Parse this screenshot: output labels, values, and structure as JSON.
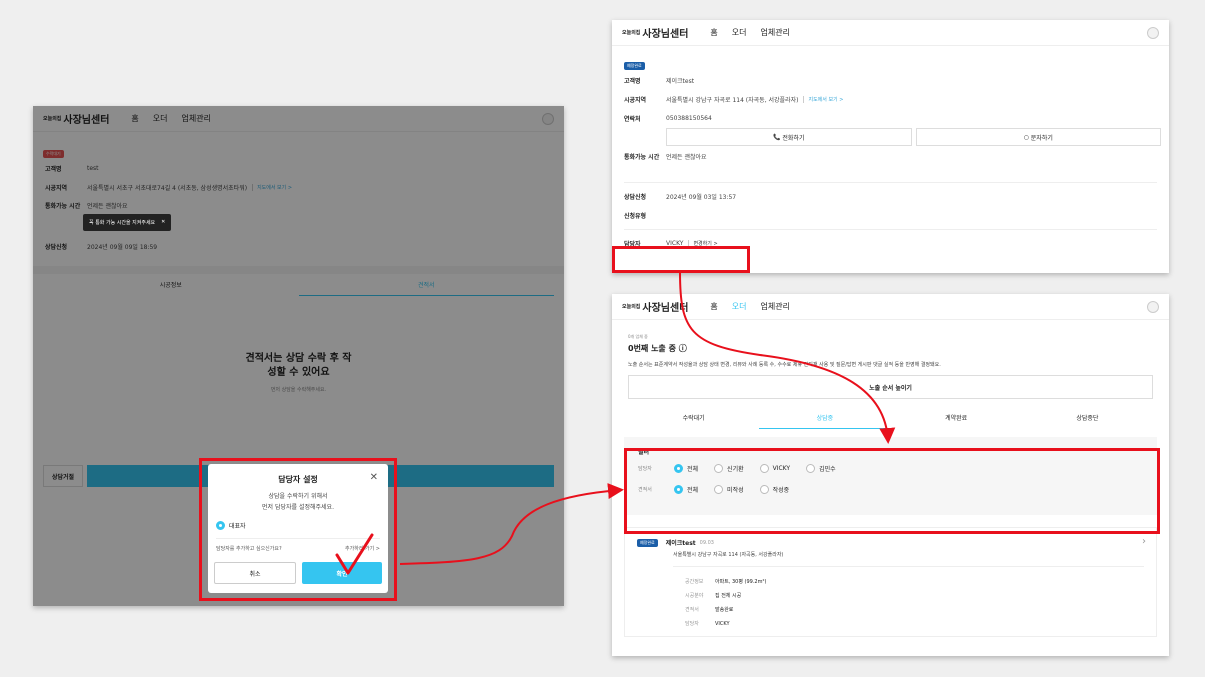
{
  "header": {
    "brand_small": "오늘의집",
    "brand": "사장님센터",
    "nav_home": "홈",
    "nav_order": "오더",
    "nav_company": "업체관리"
  },
  "left": {
    "status_badge": "수락대기",
    "name_label": "고객명",
    "name_value": "test",
    "area_label": "시공지역",
    "area_value": "서울특별시 서초구 서초대로74길 4 (서초동, 삼성생명서초타워)",
    "map_link": "지도에서 보기 >",
    "call_label": "통화가능 시간",
    "call_value": "언제든 괜찮아요",
    "tooltip": "꼭 통화 가능 시간을 지켜주세요",
    "request_label": "상담신청",
    "request_value": "2024년 09월 09일 18:59",
    "tab1": "시공정보",
    "tab2": "견적서",
    "estimate_title": "견적서는 상담 수락 후 작성할 수 있어요",
    "estimate_sub": "먼저 상담을 수락해주세요.",
    "reject_button": "상담거절",
    "modal": {
      "title": "담당자 설정",
      "body_line1": "상담을 수락하기 위해서",
      "body_line2": "먼저 담당자를 설정해주세요.",
      "option": "대표자",
      "add_question": "담당자를 추가하고 싶으신가요?",
      "add_link": "추가하러 가기 >",
      "cancel": "취소",
      "confirm": "확인"
    }
  },
  "topright": {
    "status_badge": "예정완료",
    "name_label": "고객명",
    "name_value": "제이크test",
    "area_label": "시공지역",
    "area_value": "서울특별시 강남구 자곡로 114 (자곡동, 서강플라자)",
    "map_link": "지도에서 보기 >",
    "phone_label": "연락처",
    "phone_value": "050388150564",
    "call_button": "전화하기",
    "msg_button": "문자하기",
    "call_label": "통화가능 시간",
    "call_value": "언제든 괜찮아요",
    "request_label": "상담신청",
    "request_value": "2024년 09월 03일 13:57",
    "type_label": "신청유형",
    "manager_label": "담당자",
    "manager_value": "VICKY",
    "change_link": "변경하기 >"
  },
  "bottomright": {
    "exposure_small": "0개 업체 중",
    "exposure_title": "0번째 노출 중 ⓘ",
    "exposure_desc": "노출 순서는 표준계약서 작성율과 상담 상태 변경, 리뷰와 사례 등록 수, 수수료 제휴 견지재 사용 및 질문/답변 게시판 댓글 실적 등을 반영해 결정돼요.",
    "raise_button": "노출 순서 높이기",
    "tabs": [
      "수락대기",
      "상담중",
      "계약완료",
      "상담중단"
    ],
    "filter_title": "필터",
    "filter_manager_label": "담당자",
    "filter_manager_options": [
      "전체",
      "신기환",
      "VICKY",
      "김민수"
    ],
    "filter_estimate_label": "견적서",
    "filter_estimate_options": [
      "전체",
      "미작성",
      "작성중"
    ],
    "card": {
      "badge": "예정완료",
      "name": "제이크test",
      "date": "09.03",
      "address": "서울특별시 강남구 자곡로 114 (자곡동, 서강플라자)",
      "k1": "공간정보",
      "v1": "아파트, 30평 (99.2m²)",
      "k2": "시공분야",
      "v2": "집 전체 시공",
      "k3": "견적서",
      "v3": "발송완료",
      "k4": "담당자",
      "v4": "VICKY"
    }
  },
  "colors": {
    "accent": "#35c5f0",
    "red": "#e8101c",
    "badge_blue": "#1b5ea8"
  }
}
